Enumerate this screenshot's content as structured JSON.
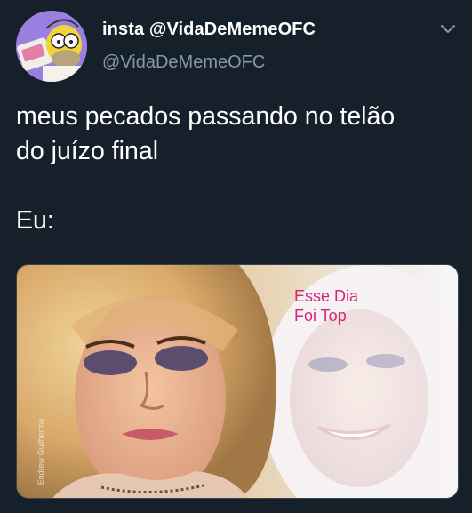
{
  "tweet": {
    "display_name": "insta @VidaDeMemeOFC",
    "handle": "@VidaDeMemeOFC",
    "text": "meus pecados passando no telão\ndo juízo final\n\nEu:",
    "menu_icon": "chevron-down-icon",
    "avatar_icon": "homer-simpson-avatar"
  },
  "media": {
    "caption": "Esse Dia\nFoi Top",
    "credit": "Endrew Guilherme"
  },
  "colors": {
    "background": "#15202b",
    "primary_text": "#ffffff",
    "secondary_text": "#8899a6",
    "caption_pink": "#d6257a"
  }
}
